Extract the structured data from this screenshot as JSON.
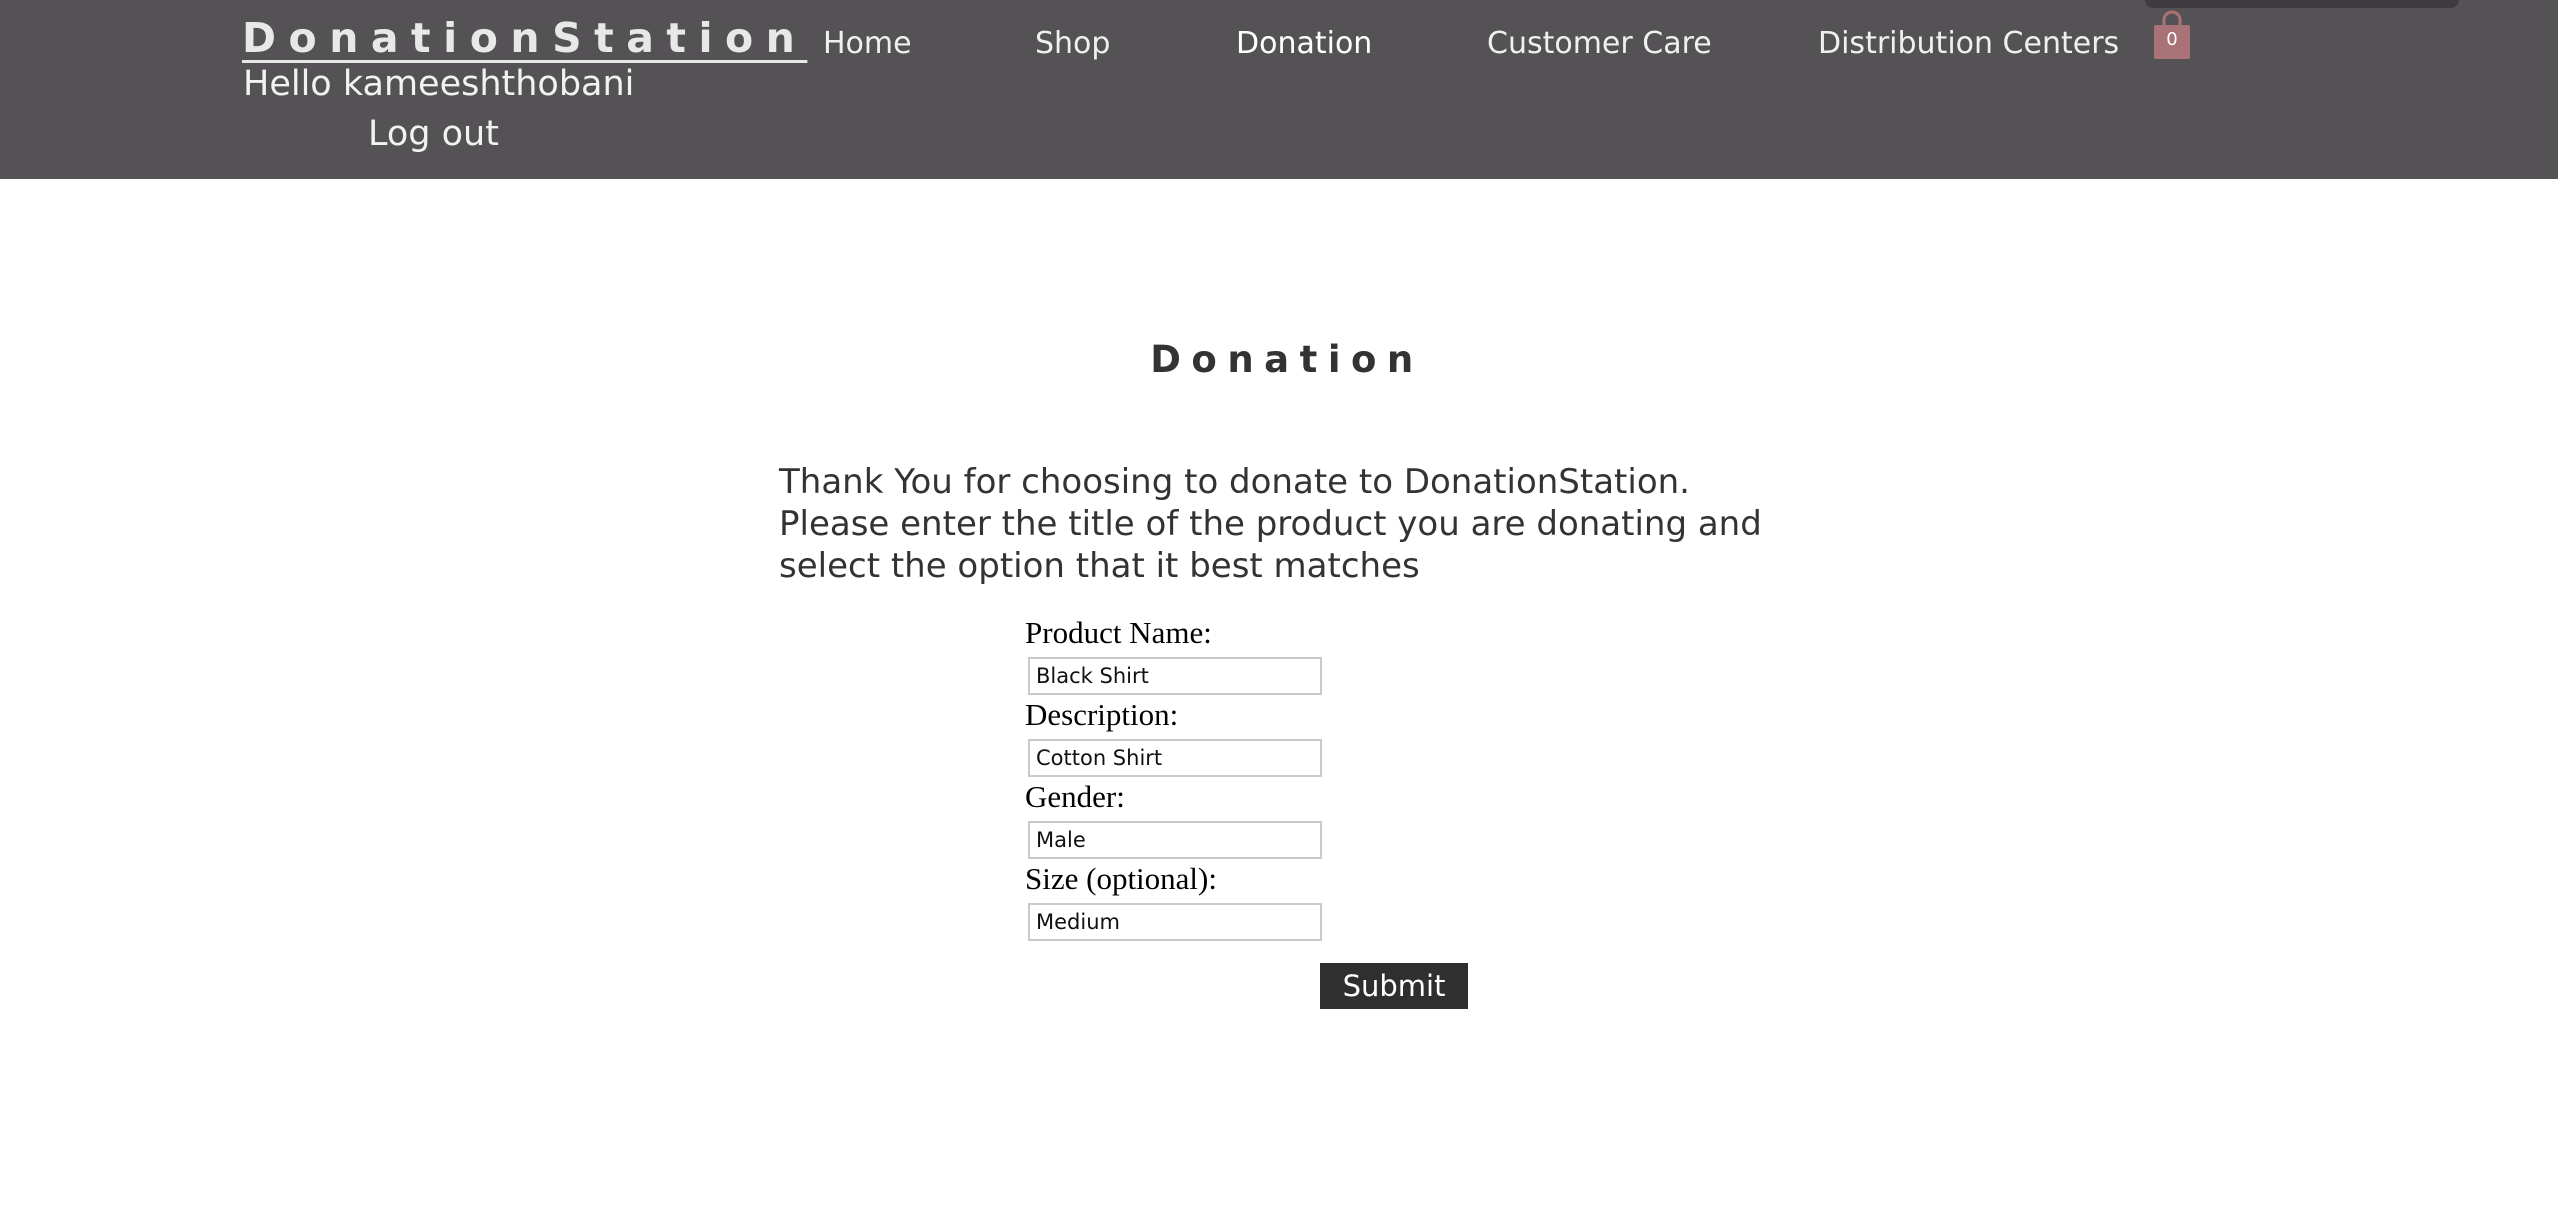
{
  "header": {
    "brand": "DonationStation",
    "greeting": "Hello kameeshthobani",
    "logout": "Log out",
    "nav": [
      {
        "label": "Home"
      },
      {
        "label": "Shop"
      },
      {
        "label": "Donation",
        "active": true
      },
      {
        "label": "Customer Care"
      },
      {
        "label": "Distribution Centers"
      }
    ],
    "cart": {
      "icon": "shopping-bag-icon",
      "count": "0",
      "color": "#a97276"
    }
  },
  "page": {
    "title": "Donation",
    "intro": "Thank You for choosing to donate to DonationStation.\nPlease enter the title of the product you are donating and\n select the option that it best matches"
  },
  "form": {
    "fields": [
      {
        "label": "Product Name:",
        "value": "Black Shirt"
      },
      {
        "label": "Description:",
        "value": "Cotton Shirt"
      },
      {
        "label": "Gender:",
        "value": "Male"
      },
      {
        "label": "Size (optional):",
        "value": "Medium"
      }
    ],
    "submit_label": "Submit"
  },
  "colors": {
    "header_bg": "#545254",
    "button_bg": "#2f2f2f"
  }
}
